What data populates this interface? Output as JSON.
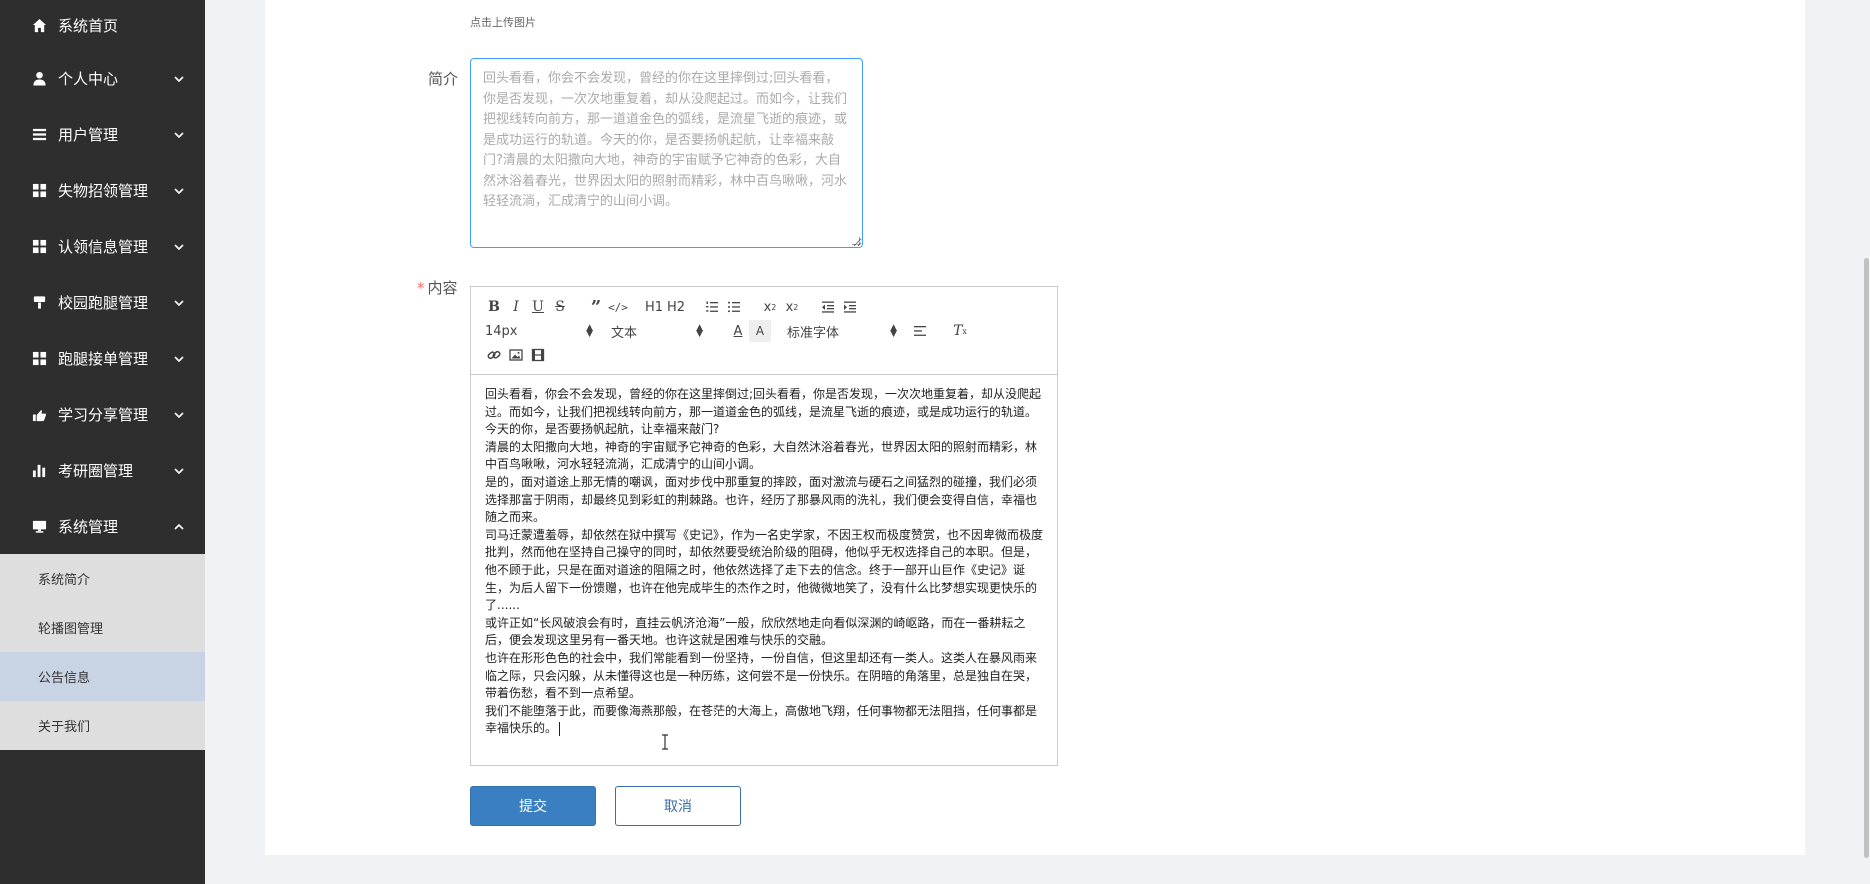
{
  "sidebar": {
    "items": [
      {
        "label": "系统首页",
        "icon": "home-icon",
        "expandable": false
      },
      {
        "label": "个人中心",
        "icon": "user-icon",
        "expandable": true
      },
      {
        "label": "用户管理",
        "icon": "list-icon",
        "expandable": true
      },
      {
        "label": "失物招领管理",
        "icon": "grid-icon",
        "expandable": true
      },
      {
        "label": "认领信息管理",
        "icon": "grid-icon",
        "expandable": true
      },
      {
        "label": "校园跑腿管理",
        "icon": "cup-icon",
        "expandable": true
      },
      {
        "label": "跑腿接单管理",
        "icon": "grid-icon",
        "expandable": true
      },
      {
        "label": "学习分享管理",
        "icon": "hand-icon",
        "expandable": true
      },
      {
        "label": "考研圈管理",
        "icon": "chart-icon",
        "expandable": true
      },
      {
        "label": "系统管理",
        "icon": "monitor-icon",
        "expandable": true,
        "expanded": true
      }
    ],
    "submenu": [
      {
        "label": "系统简介",
        "active": false
      },
      {
        "label": "轮播图管理",
        "active": false
      },
      {
        "label": "公告信息",
        "active": true
      },
      {
        "label": "关于我们",
        "active": false
      }
    ]
  },
  "form": {
    "upload_hint": "点击上传图片",
    "intro_label": "简介",
    "intro_value": "回头看看，你会不会发现，曾经的你在这里摔倒过;回头看看，你是否发现，一次次地重复着，却从没爬起过。而如今，让我们把视线转向前方，那一道道金色的弧线，是流星飞逝的痕迹，或是成功运行的轨道。今天的你，是否要扬帆起航，让幸福来敲门?清晨的太阳撒向大地，神奇的宇宙赋予它神奇的色彩，大自然沐浴着春光，世界因太阳的照射而精彩，林中百鸟啾啾，河水轻轻流淌，汇成清宁的山间小调。",
    "content_required": "*",
    "content_label": "内容",
    "toolbar": {
      "font_size": "14px",
      "header": "文本",
      "font": "标准字体",
      "h1": "H1",
      "h2": "H2"
    },
    "content_paragraphs": [
      "回头看看，你会不会发现，曾经的你在这里摔倒过;回头看看，你是否发现，一次次地重复着，却从没爬起过。而如今，让我们把视线转向前方，那一道道金色的弧线，是流星飞逝的痕迹，或是成功运行的轨道。今天的你，是否要扬帆起航，让幸福来敲门?",
      "清晨的太阳撒向大地，神奇的宇宙赋予它神奇的色彩，大自然沐浴着春光，世界因太阳的照射而精彩，林中百鸟啾啾，河水轻轻流淌，汇成清宁的山间小调。",
      "是的，面对道途上那无情的嘲讽，面对步伐中那重复的摔跤，面对激流与硬石之间猛烈的碰撞，我们必须选择那富于阴雨，却最终见到彩虹的荆棘路。也许，经历了那暴风雨的洗礼，我们便会变得自信，幸福也随之而来。",
      "司马迁蒙遭羞辱，却依然在狱中撰写《史记》，作为一名史学家，不因王权而极度赞赏，也不因卑微而极度批判，然而他在坚持自己操守的同时，却依然要受统治阶级的阻碍，他似乎无权选择自己的本职。但是，他不顾于此，只是在面对道途的阻隔之时，他依然选择了走下去的信念。终于一部开山巨作《史记》诞生，为后人留下一份馈赠，也许在他完成毕生的杰作之时，他微微地笑了，没有什么比梦想实现更快乐的了......",
      "或许正如“长风破浪会有时，直挂云帆济沧海”一般，欣欣然地走向看似深渊的崎岖路，而在一番耕耘之后，便会发现这里另有一番天地。也许这就是困难与快乐的交融。",
      "也许在形形色色的社会中，我们常能看到一份坚持，一份自信，但这里却还有一类人。这类人在暴风雨来临之际，只会闪躲，从未懂得这也是一种历练，这何尝不是一份快乐。在阴暗的角落里，总是独自在哭，带着伤愁，看不到一点希望。",
      "我们不能堕落于此，而要像海燕那般，在苍茫的大海上，高傲地飞翔，任何事物都无法阻挡，任何事都是幸福快乐的。"
    ],
    "submit_label": "提交",
    "cancel_label": "取消"
  },
  "colors": {
    "sidebar_bg": "#2e2e2e",
    "submenu_bg": "#dedede",
    "submenu_active_bg": "#c8d3e4",
    "primary": "#3a7fc2",
    "focus_border": "#409eff"
  }
}
